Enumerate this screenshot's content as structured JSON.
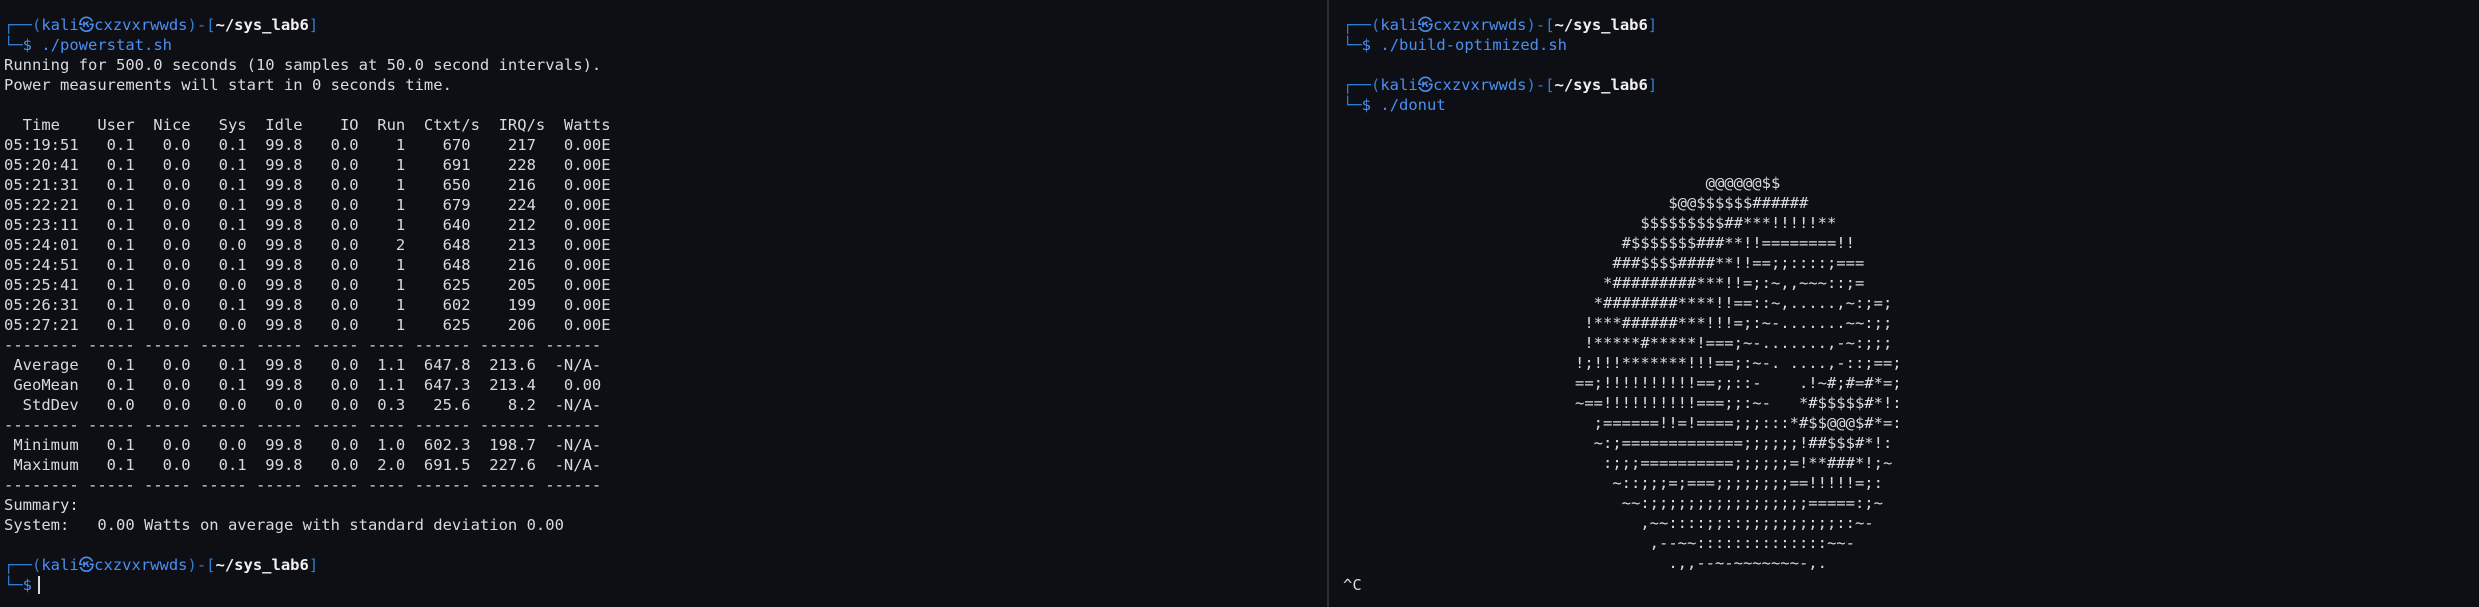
{
  "prompt": {
    "corner_top": "┌──(",
    "user": "kali",
    "at": "㉿",
    "host": "cxzvxrwwds",
    "sep": ")-[",
    "path": "~/sys_lab6",
    "close": "]",
    "corner_bottom": "└─",
    "dollar": "$"
  },
  "left": {
    "cmd1": "./powerstat.sh",
    "output": [
      "Running for 500.0 seconds (10 samples at 50.0 second intervals).",
      "Power measurements will start in 0 seconds time.",
      "",
      "  Time    User  Nice   Sys  Idle    IO  Run  Ctxt/s  IRQ/s  Watts",
      "05:19:51   0.1   0.0   0.1  99.8   0.0    1    670    217   0.00E",
      "05:20:41   0.1   0.0   0.1  99.8   0.0    1    691    228   0.00E",
      "05:21:31   0.1   0.0   0.1  99.8   0.0    1    650    216   0.00E",
      "05:22:21   0.1   0.0   0.1  99.8   0.0    1    679    224   0.00E",
      "05:23:11   0.1   0.0   0.1  99.8   0.0    1    640    212   0.00E",
      "05:24:01   0.1   0.0   0.0  99.8   0.0    2    648    213   0.00E",
      "05:24:51   0.1   0.0   0.1  99.8   0.0    1    648    216   0.00E",
      "05:25:41   0.1   0.0   0.0  99.8   0.0    1    625    205   0.00E",
      "05:26:31   0.1   0.0   0.1  99.8   0.0    1    602    199   0.00E",
      "05:27:21   0.1   0.0   0.0  99.8   0.0    1    625    206   0.00E",
      "-------- ----- ----- ----- ----- ----- ---- ------ ------ ------",
      " Average   0.1   0.0   0.1  99.8   0.0  1.1  647.8  213.6  -N/A-",
      " GeoMean   0.1   0.0   0.1  99.8   0.0  1.1  647.3  213.4   0.00",
      "  StdDev   0.0   0.0   0.0   0.0   0.0  0.3   25.6    8.2  -N/A-",
      "-------- ----- ----- ----- ----- ----- ---- ------ ------ ------",
      " Minimum   0.1   0.0   0.0  99.8   0.0  1.0  602.3  198.7  -N/A-",
      " Maximum   0.1   0.0   0.1  99.8   0.0  2.0  691.5  227.6  -N/A-",
      "-------- ----- ----- ----- ----- ----- ---- ------ ------ ------",
      "Summary:",
      "System:   0.00 Watts on average with standard deviation 0.00"
    ]
  },
  "right": {
    "cmd1": "./build-optimized.sh",
    "cmd2": "./donut",
    "donut": [
      "              @@@@@@$$",
      "          $@@$$$$$$######",
      "       $$$$$$$$$##***!!!!!**",
      "     #$$$$$$$###**!!========!!",
      "    ###$$$$####**!!==;;::::;===",
      "   *#########***!!=;:~,,~~~::;=",
      "  *########****!!==::~,.....,~:;=;",
      " !***######***!!!=;:~-.......~~:;;",
      " !*****#*****!===;~-.......,-~:;;;",
      "!;!!!*******!!!==;:~-. ....,-::;==;",
      "==;!!!!!!!!!!==;;::-    .!~#;#=#*=;",
      "~==!!!!!!!!!!===;;:~-   *#$$$$$#*!:",
      "  ;======!!=!====;;;:::*#$$@@@$#*=:",
      "  ~:;=============;;;;;;!##$$$#*!:",
      "   :;;;==========;;;;;;=!**###*!;~",
      "    ~::;;;=;===;;;;;;;;==!!!!!=;:",
      "     ~~:;;;;;;;;;;;;;;;;;=====:;~",
      "       ,~~::::;;::;;;;;;;;;;::~-",
      "        ,--~~::::::::::::::~~-",
      "          .,,--~-~~~~~~~-,."
    ],
    "interrupt": "^C"
  }
}
